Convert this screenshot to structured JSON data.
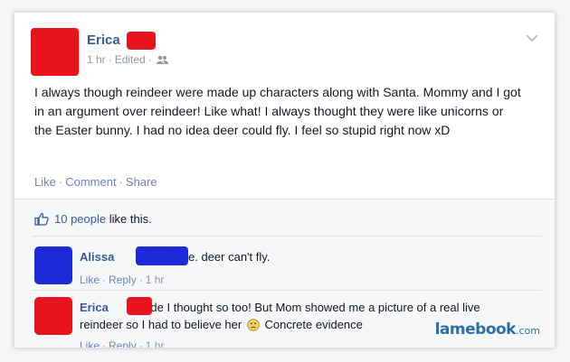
{
  "post": {
    "author": "Erica",
    "time": "1 hr",
    "edited": "Edited",
    "meta_sep": "·",
    "audience_icon": "friends-icon",
    "text": "I always though reindeer were made up characters along with Santa. Mommy and I got in an argument over reindeer! Like what! I always thought they were like unicorns or the Easter bunny. I had no idea deer could fly. I feel so stupid right now xD",
    "actions": {
      "like": "Like",
      "comment": "Comment",
      "share": "Share",
      "sep": "·"
    }
  },
  "likes": {
    "icon": "thumbs-up-icon",
    "count": "10 people",
    "suffix": "like this."
  },
  "comments": [
    {
      "name": "Alissa",
      "text": "babe. deer can't fly.",
      "like": "Like",
      "reply": "Reply",
      "time": "1 hr",
      "avatar_color": "#1c2bd9"
    },
    {
      "name": "Erica",
      "text_before": "Dude I thought so too! But Mom showed me a picture of a real live reindeer so I had to believe her",
      "emoji": "frown-emoji-icon",
      "text_after": "Concrete evidence",
      "like": "Like",
      "reply": "Reply",
      "time": "1 hr",
      "avatar_color": "#e8141d"
    }
  ],
  "watermark": {
    "brand": "lamebook",
    "tld": ".com"
  },
  "colors": {
    "link": "#3b5998",
    "redaction_red": "#e8141d",
    "redaction_blue": "#1c2bd9"
  }
}
